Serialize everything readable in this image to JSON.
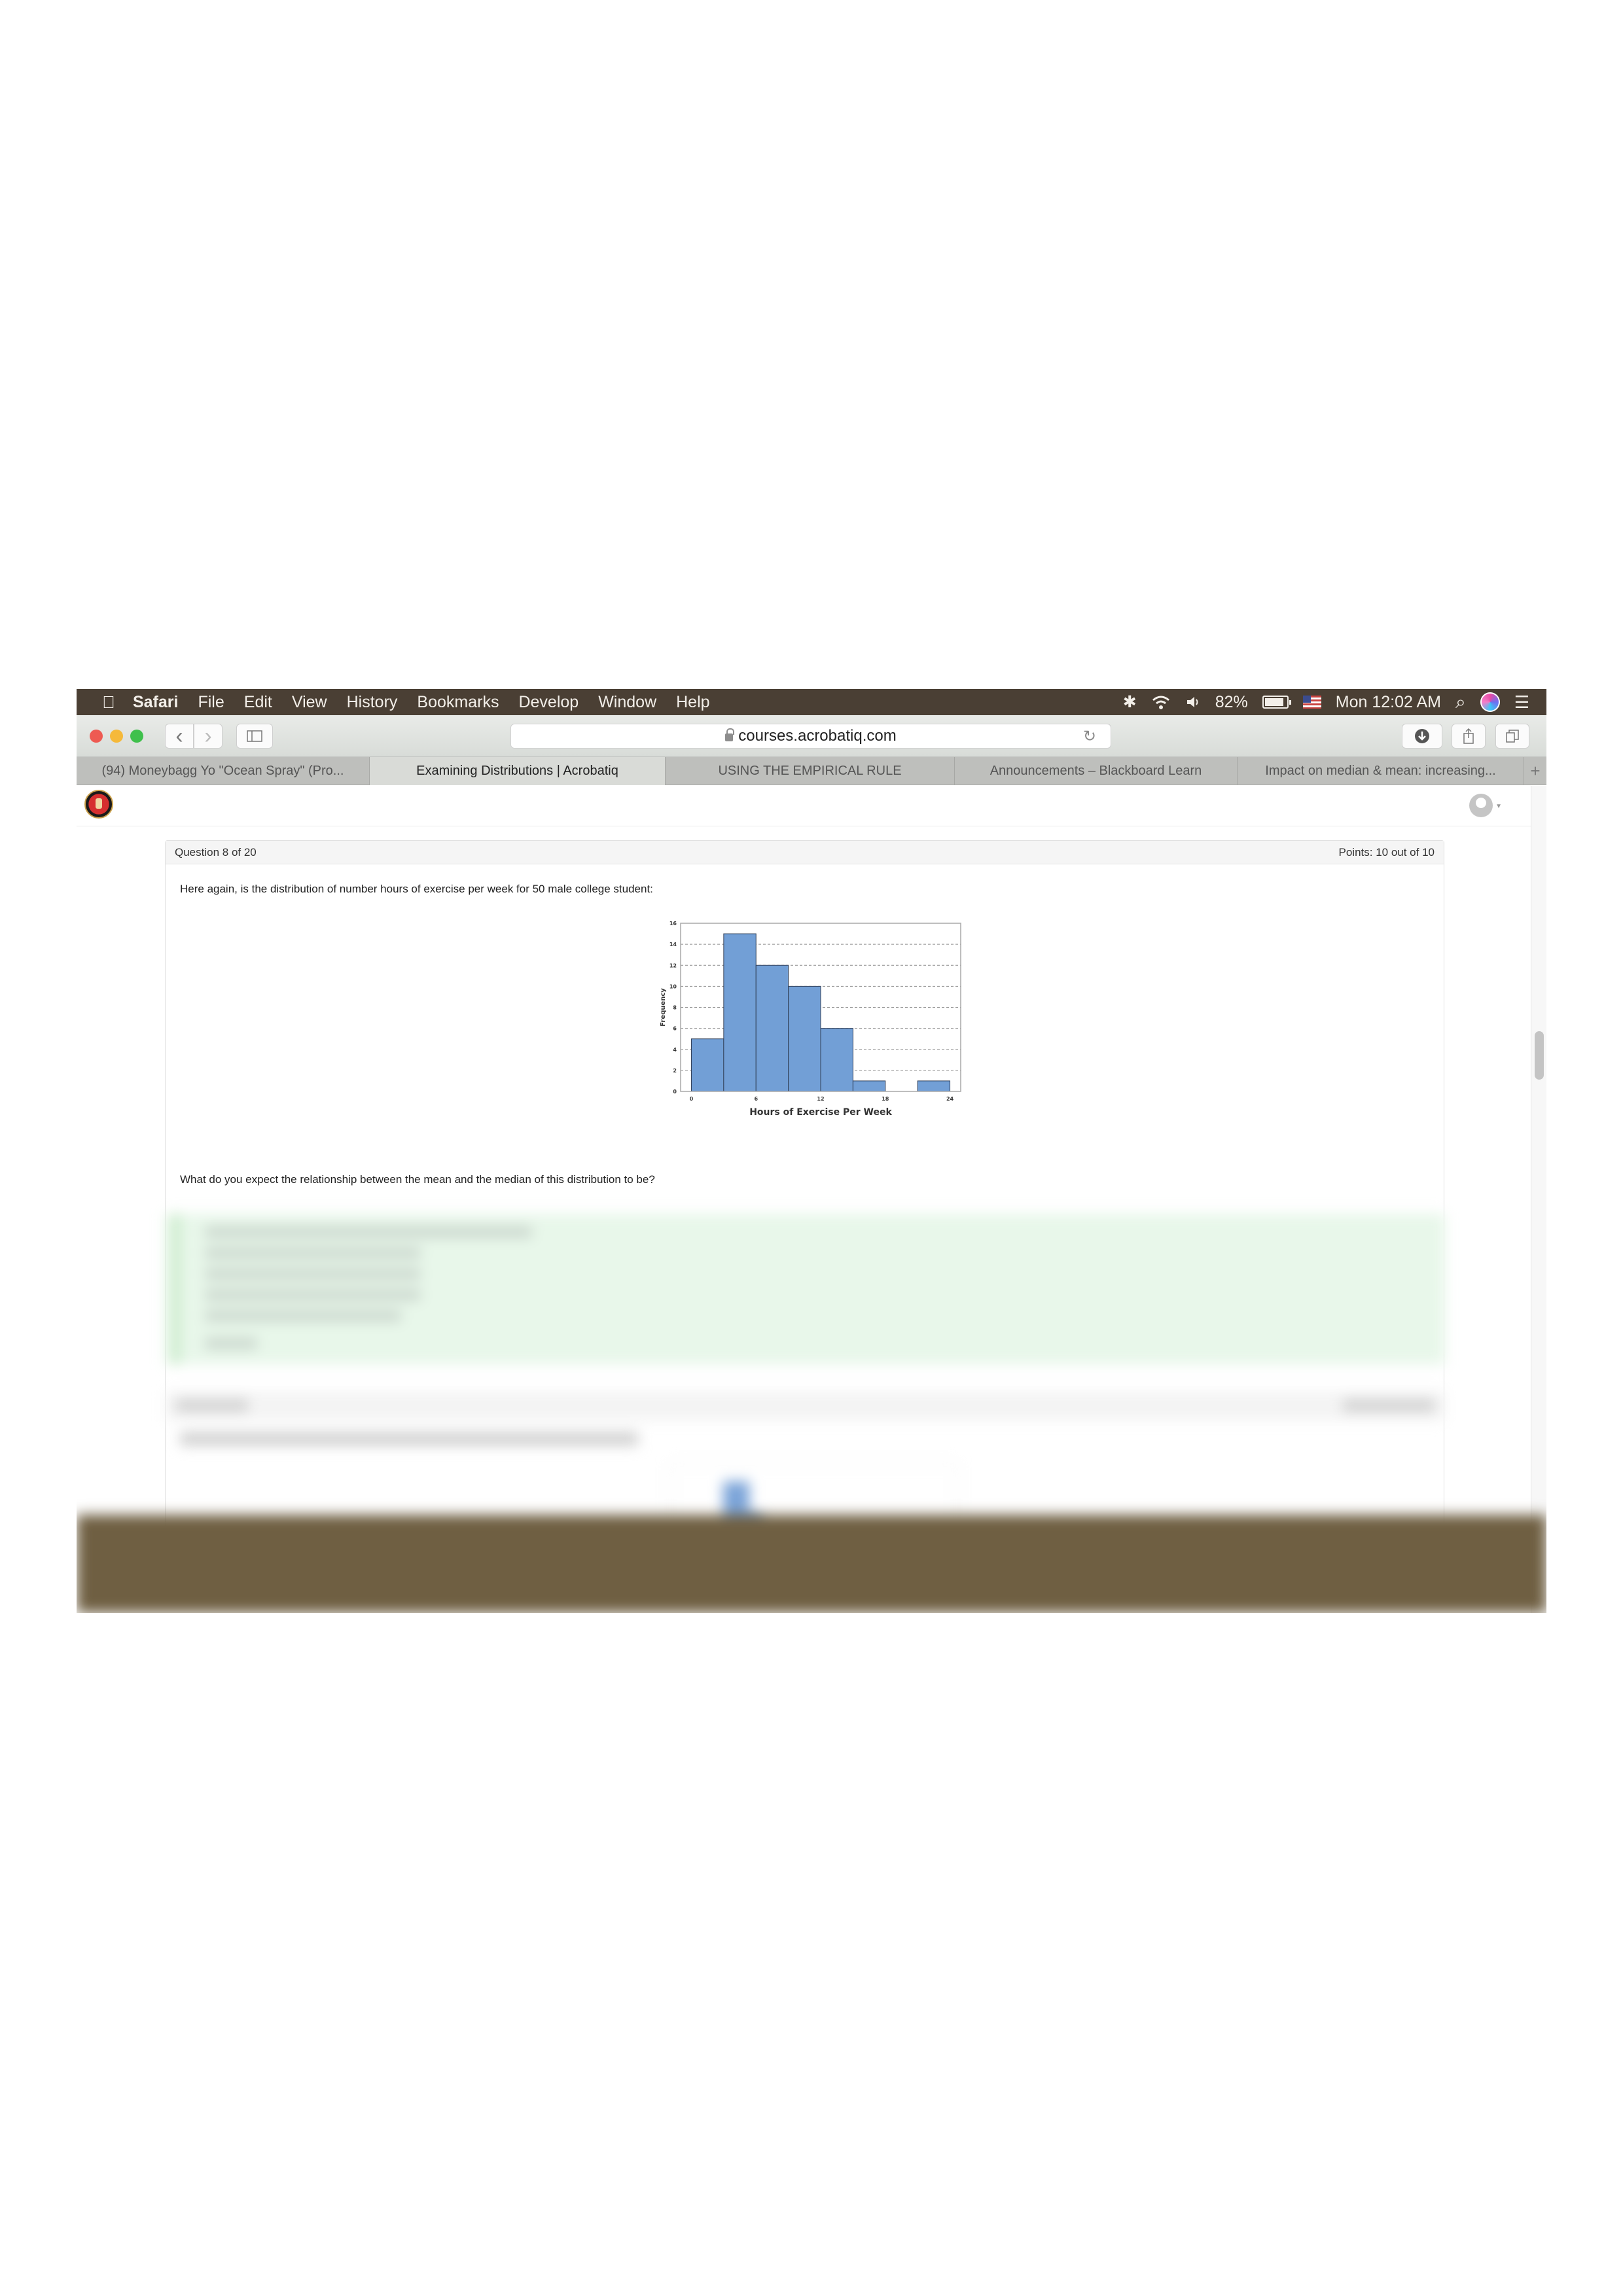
{
  "menubar": {
    "apple_icon": "apple-icon",
    "app_name": "Safari",
    "items": [
      "File",
      "Edit",
      "View",
      "History",
      "Bookmarks",
      "Develop",
      "Window",
      "Help"
    ],
    "status": {
      "bluetooth_icon": "✱",
      "wifi_icon": "◔",
      "volume_icon": "◀)",
      "battery_percent": "82%",
      "battery_level": 0.82,
      "clock": "Mon 12:02 AM",
      "search_icon": "⌕",
      "list_icon": "☰"
    }
  },
  "toolbar": {
    "back_icon": "‹",
    "forward_icon": "›",
    "sidebar_icon": "▯",
    "url": "courses.acrobatiq.com",
    "reload_icon": "↻",
    "download_icon": "⬇",
    "share_icon": "⇪",
    "tabs_icon": "⧉"
  },
  "tabs": [
    {
      "label": "(94) Moneybagg Yo \"Ocean Spray\" (Pro...",
      "active": false
    },
    {
      "label": "Examining Distributions | Acrobatiq",
      "active": true
    },
    {
      "label": "USING THE EMPIRICAL RULE",
      "active": false
    },
    {
      "label": "Announcements – Blackboard Learn",
      "active": false
    },
    {
      "label": "Impact on median & mean: increasing...",
      "active": false
    }
  ],
  "new_tab_label": "+",
  "question": {
    "header_left": "Question 8 of 20",
    "header_right": "Points: 10 out of 10",
    "text": "Here again, is the distribution of number hours of exercise per week for 50 male college student:",
    "prompt": "What do you expect the relationship between the mean and the median of this distribution to be?"
  },
  "chart_data": {
    "type": "bar",
    "subtype": "histogram",
    "title": "",
    "xlabel": "Hours of Exercise Per Week",
    "ylabel": "Frequency",
    "bin_edges": [
      0,
      3,
      6,
      9,
      12,
      15,
      18,
      21,
      24
    ],
    "values": [
      5,
      15,
      12,
      10,
      6,
      1,
      0,
      1
    ],
    "xticks": [
      0,
      6,
      12,
      18,
      24
    ],
    "yticks": [
      0,
      2,
      4,
      6,
      8,
      10,
      12,
      14,
      16
    ],
    "xlim": [
      -1,
      25
    ],
    "ylim": [
      0,
      16
    ],
    "grid": "horizontal dashed",
    "bar_color": "#729fd6",
    "legend": "none"
  }
}
